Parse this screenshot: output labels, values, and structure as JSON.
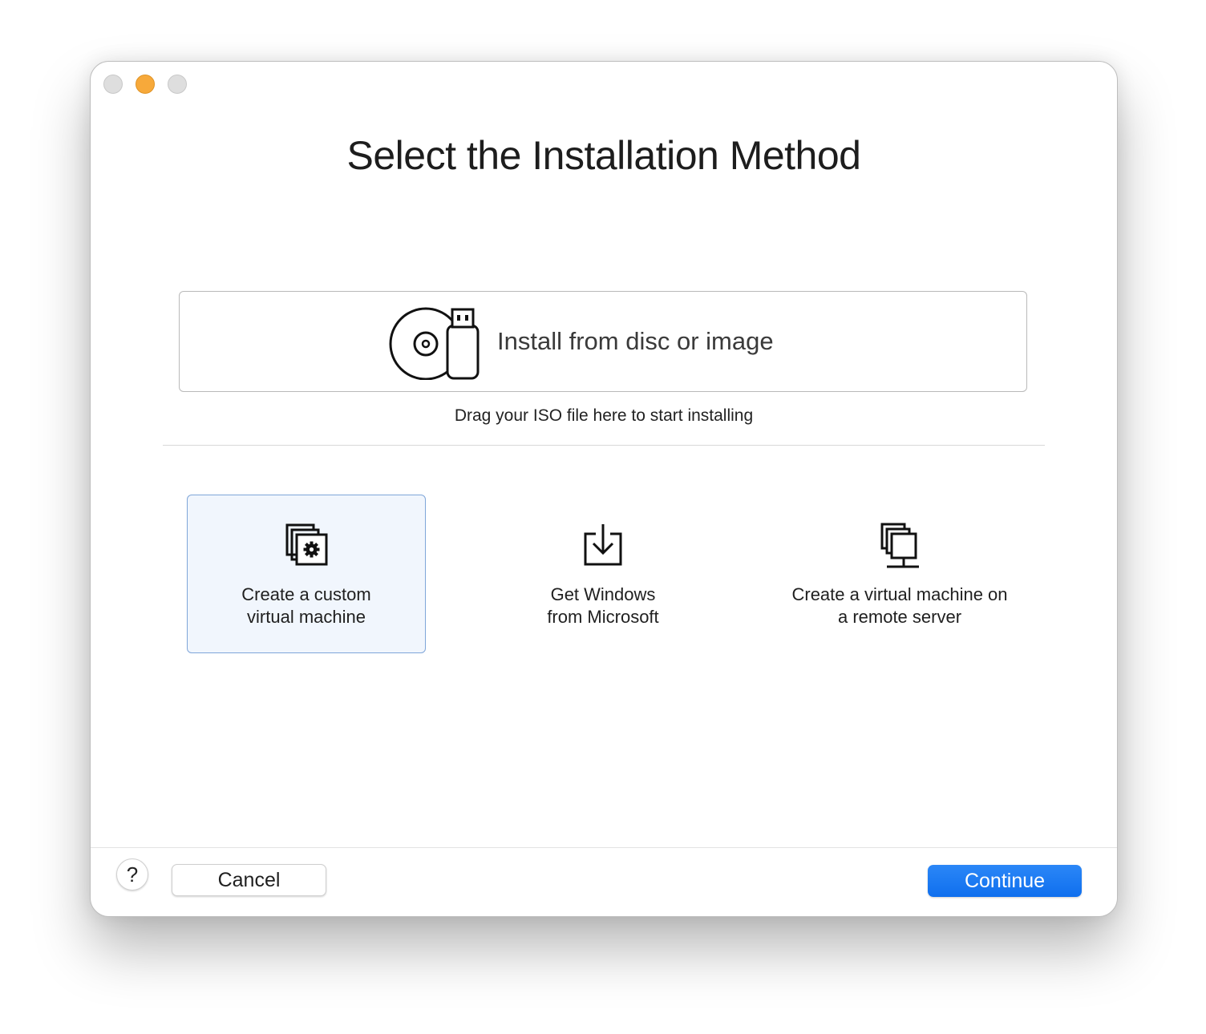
{
  "window": {
    "title": "Select the Installation Method"
  },
  "disc_option": {
    "label": "Install from disc or image",
    "icon": "disc-usb-icon"
  },
  "drag_hint": "Drag your ISO file here to start installing",
  "options": [
    {
      "line1": "Create a custom",
      "line2": "virtual machine",
      "icon": "vm-gear-icon",
      "selected": true
    },
    {
      "line1": "Get Windows",
      "line2": "from Microsoft",
      "icon": "download-icon",
      "selected": false
    },
    {
      "line1": "Create a virtual machine on",
      "line2": "a remote server",
      "icon": "remote-server-icon",
      "selected": false
    }
  ],
  "footer": {
    "help_label": "?",
    "cancel_label": "Cancel",
    "continue_label": "Continue"
  },
  "colors": {
    "accent": "#1a7cf5",
    "selected_bg": "#f1f6fd",
    "selected_border": "#7fa6d9",
    "minimize_light": "#f7a93a"
  }
}
